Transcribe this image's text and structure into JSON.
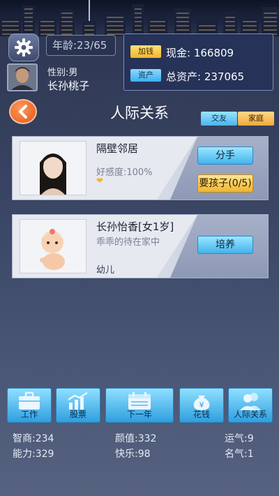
{
  "header": {
    "age": "年龄:23/65",
    "gender": "性别:男",
    "name": "长孙桃子",
    "cash_tag": "加钱",
    "cash": "现金: 166809",
    "assets_tag": "资产",
    "assets": "总资产: 237065"
  },
  "page": {
    "title": "人际关系",
    "tabs": [
      "交友",
      "家庭"
    ]
  },
  "relations": [
    {
      "name": "隔壁邻居",
      "favor": "好感度:100%",
      "buttons": [
        "分手",
        "要孩子(0/5)"
      ]
    },
    {
      "name": "长孙怡香[女1岁]",
      "status": "乖乖的待在家中",
      "stage": "幼儿",
      "buttons": [
        "培养"
      ]
    }
  ],
  "nav": {
    "items": [
      "工作",
      "股票",
      "下一年",
      "花钱",
      "人际关系"
    ]
  },
  "stats": {
    "iq": "智商:234",
    "ability": "能力:329",
    "looks": "颜值:332",
    "happiness": "快乐:98",
    "luck": "运气:9",
    "fame": "名气:1"
  },
  "colors": {
    "accent_blue": "#43b3ec",
    "accent_yellow": "#f2b52e",
    "back_orange": "#e0561a"
  }
}
